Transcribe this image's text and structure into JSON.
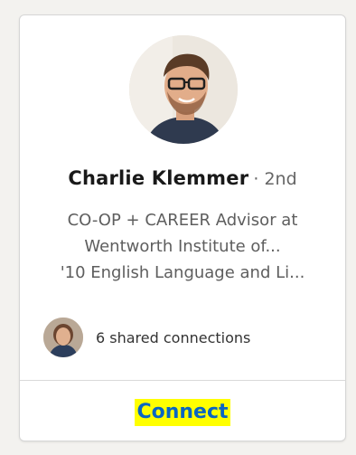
{
  "profile": {
    "name": "Charlie Klemmer",
    "degree": "· 2nd",
    "headline_lines": [
      "CO-OP + CAREER Advisor at",
      "Wentworth Institute of...",
      "'10 English Language and Li..."
    ]
  },
  "shared_connections": {
    "label": "6 shared connections"
  },
  "actions": {
    "connect_label": "Connect"
  },
  "colors": {
    "link": "#0a66c2",
    "highlight": "#ffff00",
    "card_border": "#d6d6d6",
    "muted_text": "#5e5e5e"
  }
}
